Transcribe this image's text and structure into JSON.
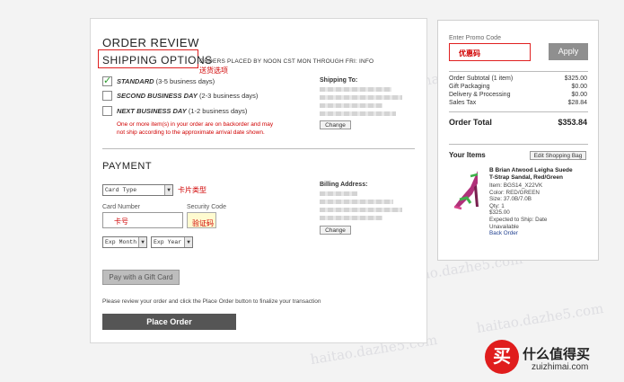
{
  "order_review": {
    "title": "ORDER REVIEW",
    "shipping_options_title": "SHIPPING OPTIONS",
    "shipping_cutoff_note": "ORDERS PLACED BY NOON CST MON THROUGH FRI: INFO",
    "shipping_options_annotation": "送货选项",
    "options": [
      {
        "name": "STANDARD",
        "detail": "(3-5 business days)",
        "checked": true
      },
      {
        "name": "SECOND BUSINESS DAY",
        "detail": "(2-3 business days)",
        "checked": false
      },
      {
        "name": "NEXT BUSINESS DAY",
        "detail": "(1-2 business days)",
        "checked": false
      }
    ],
    "backorder_warning_line1": "One or more item(s) in your order are on backorder and may",
    "backorder_warning_line2": "not ship according to the approximate arrival date shown.",
    "shipping_to_label": "Shipping To:",
    "change_label": "Change"
  },
  "payment": {
    "title": "PAYMENT",
    "card_type_value": "Card Type",
    "card_type_annotation": "卡片类型",
    "card_number_label": "Card Number",
    "card_number_annotation": "卡号",
    "security_code_label": "Security Code",
    "security_code_annotation": "验证码",
    "exp_month_value": "Exp Month",
    "exp_year_value": "Exp Year",
    "gift_card_button": "Pay with a Gift Card",
    "billing_address_label": "Billing Address:",
    "change_label": "Change",
    "finalize_note": "Please review your order and click the Place Order button to finalize your transaction",
    "place_order_button": "Place Order"
  },
  "summary": {
    "promo_label": "Enter Promo Code",
    "promo_value": "优惠码",
    "apply_button": "Apply",
    "lines": [
      {
        "label": "Order Subtotal (1 item)",
        "value": "$325.00"
      },
      {
        "label": "Gift Packaging",
        "value": "$0.00"
      },
      {
        "label": "Delivery & Processing",
        "value": "$0.00"
      },
      {
        "label": "Sales Tax",
        "value": "$28.84"
      }
    ],
    "total_label": "Order Total",
    "total_value": "$353.84",
    "your_items_label": "Your Items",
    "edit_bag_button": "Edit Shopping Bag",
    "item": {
      "name_line1": "B Brian Atwood Leigha Suede",
      "name_line2": "T-Strap Sandal, Red/Green",
      "item_no": "Item: BGS14_X22VK",
      "color": "Color: RED/GREEN",
      "size": "Size: 37.0B/7.0B",
      "qty": "Qty: 1",
      "price": "$325.00",
      "expected_line1": "Expected to Ship: Date",
      "expected_line2": "Unavailable",
      "status": "Back Order"
    }
  },
  "brand": {
    "logo_char": "买",
    "name_cn": "什么值得买",
    "url": "zuizhimai.com"
  },
  "watermark_text": "haitao.dazhe5.com"
}
